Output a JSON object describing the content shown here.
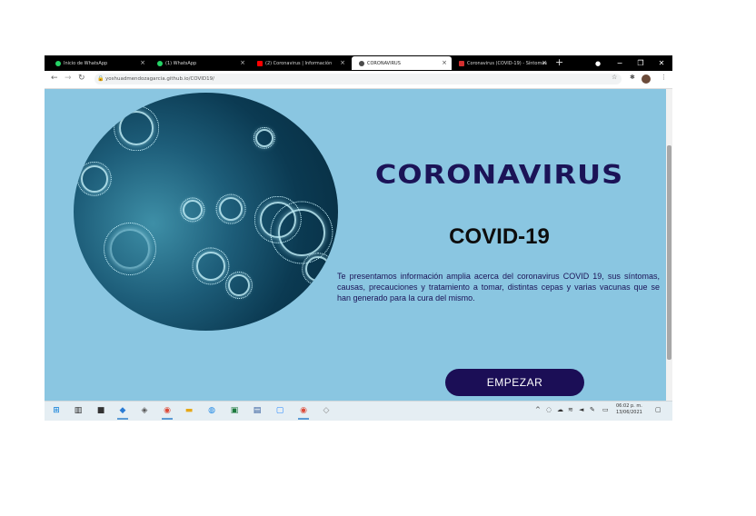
{
  "browser": {
    "tabs": [
      {
        "label": "Inicio de WhatsApp",
        "color": "#25d366"
      },
      {
        "label": "(1) WhatsApp",
        "color": "#25d366"
      },
      {
        "label": "(2) Coronavirus | Información",
        "color": "#ff0000"
      },
      {
        "label": "CORONAVIRUS",
        "color": "#4a4a4a"
      },
      {
        "label": "Coronavirus (COVID-19) - Síntomas",
        "color": "#d32f2f"
      }
    ],
    "new_tab": "+",
    "url": "yoshuadmendozagarcia.github.io/COVID19/",
    "minimize": "−",
    "maximize": "❐",
    "close": "✕"
  },
  "page": {
    "title": "CORONAVIRUS",
    "subtitle": "COVID-19",
    "description": "Te presentamos información amplia acerca del coronavirus COVID 19, sus síntomas, causas, precauciones y tratamiento a tomar, distintas cepas y varias vacunas que se han generado para la cura del mismo.",
    "start_button": "EMPEZAR"
  },
  "taskbar": {
    "clock_time": "06:02 p. m.",
    "clock_date": "13/06/2021"
  },
  "colors": {
    "page_background": "#8ac6e1",
    "title": "#1b1357",
    "button": "#1b0e56"
  }
}
